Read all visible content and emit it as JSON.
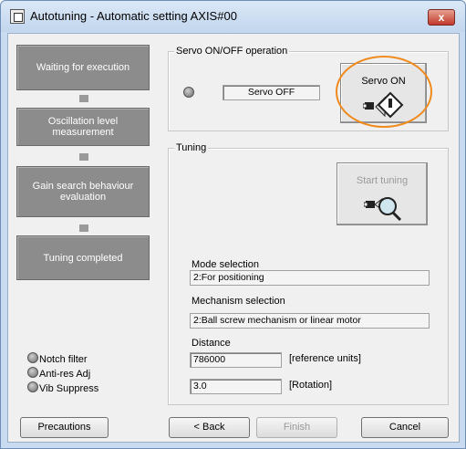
{
  "window": {
    "title": "Autotuning - Automatic setting AXIS#00",
    "close_symbol": "x"
  },
  "steps": [
    {
      "label": "Waiting for execution"
    },
    {
      "label": "Oscillation level measurement"
    },
    {
      "label": "Gain search behaviour evaluation"
    },
    {
      "label": "Tuning completed"
    }
  ],
  "indicators": [
    {
      "label": "Notch filter"
    },
    {
      "label": "Anti-res Adj"
    },
    {
      "label": "Vib Suppress"
    }
  ],
  "servo": {
    "group_label": "Servo ON/OFF operation",
    "status": "Servo OFF",
    "button_label": "Servo ON"
  },
  "tuning": {
    "group_label": "Tuning",
    "start_label": "Start tuning",
    "mode_label": "Mode selection",
    "mode_value": "2:For positioning",
    "mechanism_label": "Mechanism selection",
    "mechanism_value": "2:Ball screw mechanism or linear motor",
    "distance_label": "Distance",
    "distance_value": "786000",
    "distance_unit": "[reference units]",
    "rotation_value": "3.0",
    "rotation_unit": "[Rotation]"
  },
  "footer": {
    "precautions": "Precautions",
    "back": "< Back",
    "finish": "Finish",
    "cancel": "Cancel"
  },
  "colors": {
    "highlight": "#f08a1c",
    "step_fill": "#8c8c8c",
    "close_button": "#c0392b"
  }
}
